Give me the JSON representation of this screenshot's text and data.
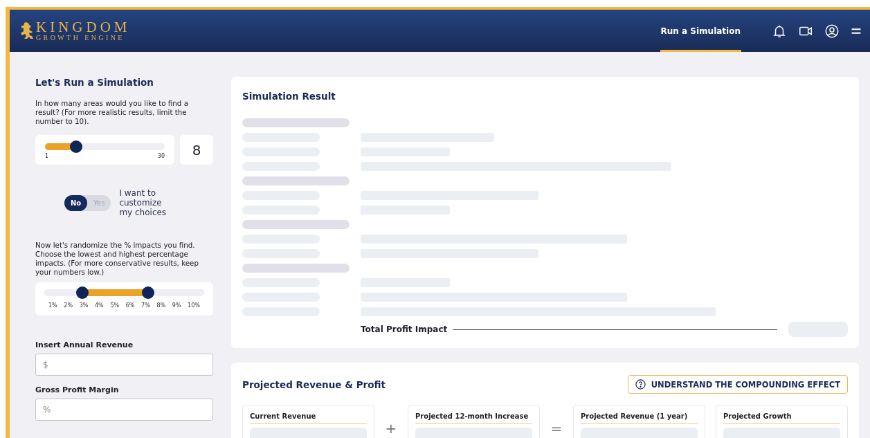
{
  "header": {
    "logo": {
      "title": "KINGDOM",
      "subtitle": "GROWTH ENGINE"
    },
    "nav": [
      {
        "label": "Run a Simulation",
        "selected": true
      }
    ]
  },
  "sidebar": {
    "title": "Let's Run a Simulation",
    "areas_prompt": "In how many areas would you like to find a result? (For more realistic results, limit the number to 10).",
    "areas_slider": {
      "level": 0.26,
      "min_label": "1",
      "max_label": "30",
      "value": "8"
    },
    "customize_toggle": {
      "options": [
        {
          "label": "No",
          "selected": true
        },
        {
          "label": "Yes",
          "selected": false
        }
      ],
      "label": "I want to customize my choices"
    },
    "impact_prompt": "Now let's randomize the % impacts you find. Choose the lowest and highest percentage impacts.  (For more conservative results, keep your numbers low.)",
    "impact_slider": {
      "thumbs": [
        {
          "level": 0.24
        },
        {
          "level": 0.65
        }
      ],
      "ticks": [
        "1%",
        "2%",
        "3%",
        "4%",
        "5%",
        "6%",
        "7%",
        "8%",
        "9%",
        "10%"
      ]
    },
    "fields": [
      {
        "label": "Insert Annual Revenue",
        "placeholder": "$"
      },
      {
        "label": "Gross Profit Margin",
        "placeholder": "%"
      }
    ]
  },
  "simulation_result": {
    "title": "Simulation Result",
    "total_label": "Total Profit Impact"
  },
  "projected": {
    "title": "Projected Revenue & Profit",
    "button": "UNDERSTAND THE COMPOUNDING EFFECT",
    "cards": [
      {
        "label": "Current Revenue",
        "operator": "+"
      },
      {
        "label": "Projected 12-month Increase",
        "operator": "="
      },
      {
        "label": "Projected Revenue (1 year)"
      },
      {
        "label": "Projected Growth"
      }
    ]
  }
}
